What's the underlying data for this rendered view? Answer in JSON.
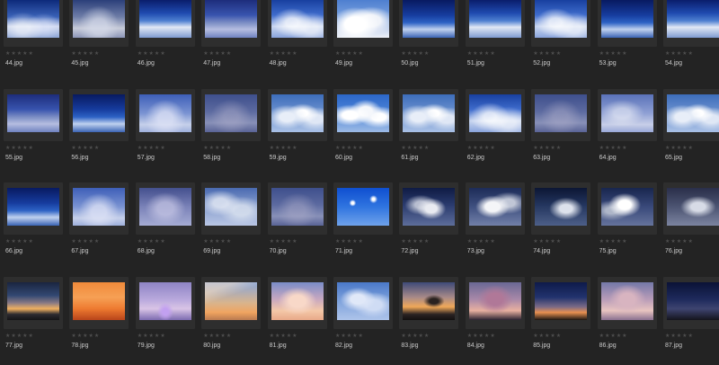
{
  "gallery": {
    "rating_placeholder": "★★★★★",
    "rows": [
      {
        "items": [
          {
            "file": "44.jpg",
            "thumb": "sky-a"
          },
          {
            "file": "45.jpg",
            "thumb": "sky-b"
          },
          {
            "file": "46.jpg",
            "thumb": "sky-c"
          },
          {
            "file": "47.jpg",
            "thumb": "sky-d"
          },
          {
            "file": "48.jpg",
            "thumb": "sky-e"
          },
          {
            "file": "49.jpg",
            "thumb": "cloud-white"
          },
          {
            "file": "50.jpg",
            "thumb": "sky-deep"
          },
          {
            "file": "51.jpg",
            "thumb": "sky-c"
          },
          {
            "file": "52.jpg",
            "thumb": "sky-e"
          },
          {
            "file": "53.jpg",
            "thumb": "sky-deep"
          },
          {
            "file": "54.jpg",
            "thumb": "sky-c"
          }
        ]
      },
      {
        "items": [
          {
            "file": "55.jpg",
            "thumb": "sky-d"
          },
          {
            "file": "56.jpg",
            "thumb": "sky-deep"
          },
          {
            "file": "57.jpg",
            "thumb": "sky-pale"
          },
          {
            "file": "58.jpg",
            "thumb": "slate"
          },
          {
            "file": "59.jpg",
            "thumb": "fluffy"
          },
          {
            "file": "60.jpg",
            "thumb": "cumulus"
          },
          {
            "file": "61.jpg",
            "thumb": "fluffy"
          },
          {
            "file": "62.jpg",
            "thumb": "sky-e"
          },
          {
            "file": "63.jpg",
            "thumb": "slate"
          },
          {
            "file": "64.jpg",
            "thumb": "soft"
          },
          {
            "file": "65.jpg",
            "thumb": "fluffy"
          }
        ]
      },
      {
        "items": [
          {
            "file": "66.jpg",
            "thumb": "sky-deep"
          },
          {
            "file": "67.jpg",
            "thumb": "sky-pale"
          },
          {
            "file": "68.jpg",
            "thumb": "lilac"
          },
          {
            "file": "69.jpg",
            "thumb": "dense"
          },
          {
            "file": "70.jpg",
            "thumb": "slate"
          },
          {
            "file": "71.jpg",
            "thumb": "bluesky"
          },
          {
            "file": "72.jpg",
            "thumb": "storm"
          },
          {
            "file": "73.jpg",
            "thumb": "storm2"
          },
          {
            "file": "74.jpg",
            "thumb": "storm3"
          },
          {
            "file": "75.jpg",
            "thumb": "storm4"
          },
          {
            "file": "76.jpg",
            "thumb": "storm5"
          }
        ]
      },
      {
        "items": [
          {
            "file": "77.jpg",
            "thumb": "sunset1"
          },
          {
            "file": "78.jpg",
            "thumb": "orange"
          },
          {
            "file": "79.jpg",
            "thumb": "purple"
          },
          {
            "file": "80.jpg",
            "thumb": "wisp"
          },
          {
            "file": "81.jpg",
            "thumb": "pinkcloud"
          },
          {
            "file": "82.jpg",
            "thumb": "bluecloud"
          },
          {
            "file": "83.jpg",
            "thumb": "dusk1"
          },
          {
            "file": "84.jpg",
            "thumb": "dusk2"
          },
          {
            "file": "85.jpg",
            "thumb": "dusk3"
          },
          {
            "file": "86.jpg",
            "thumb": "dusk4"
          },
          {
            "file": "87.jpg",
            "thumb": "dusk5"
          }
        ]
      }
    ]
  }
}
